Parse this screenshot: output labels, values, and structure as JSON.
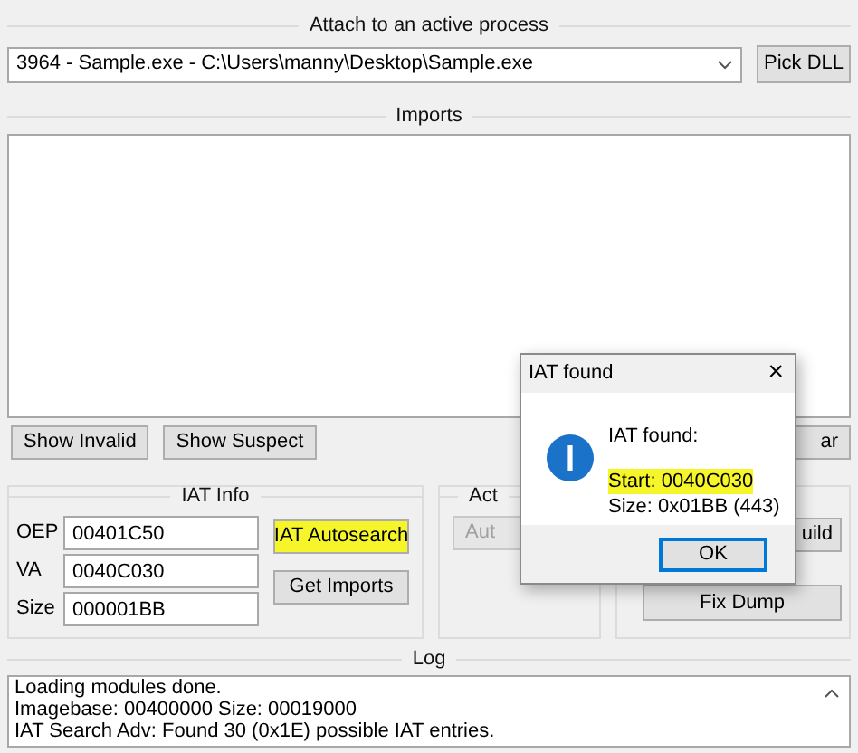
{
  "attach_group": {
    "title": "Attach to an active process",
    "process_select": {
      "value": "3964 - Sample.exe - C:\\Users\\manny\\Desktop\\Sample.exe"
    },
    "pick_dll_button": "Pick DLL"
  },
  "imports_group": {
    "title": "Imports",
    "buttons": [
      {
        "label": "Show Invalid"
      },
      {
        "label": "Show Suspect"
      },
      {
        "label": "ar"
      }
    ]
  },
  "iat_info": {
    "title": "IAT Info",
    "fields": [
      {
        "label": "OEP",
        "value": "00401C50"
      },
      {
        "label": "VA",
        "value": "0040C030"
      },
      {
        "label": "Size",
        "value": "000001BB"
      }
    ],
    "buttons": [
      {
        "label": "IAT Autosearch",
        "highlighted": true
      },
      {
        "label": "Get Imports",
        "highlighted": false
      }
    ]
  },
  "actions_group": {
    "title": "Act",
    "buttons": [
      {
        "label": "Aut",
        "disabled": true
      }
    ]
  },
  "dump_group": {
    "buttons": [
      {
        "label": "uild"
      },
      {
        "label": "Fix Dump"
      }
    ]
  },
  "log": {
    "title": "Log",
    "lines": [
      "Loading modules done.",
      "Imagebase: 00400000 Size: 00019000",
      "IAT Search Adv: Found 30 (0x1E) possible IAT entries."
    ]
  },
  "dialog": {
    "title": "IAT found",
    "close": "×",
    "heading": "IAT found:",
    "lines": [
      {
        "text": "Start: 0040C030",
        "highlighted": true
      },
      {
        "text": "Size: 0x01BB (443)",
        "highlighted": false
      }
    ],
    "ok_button": "OK"
  }
}
